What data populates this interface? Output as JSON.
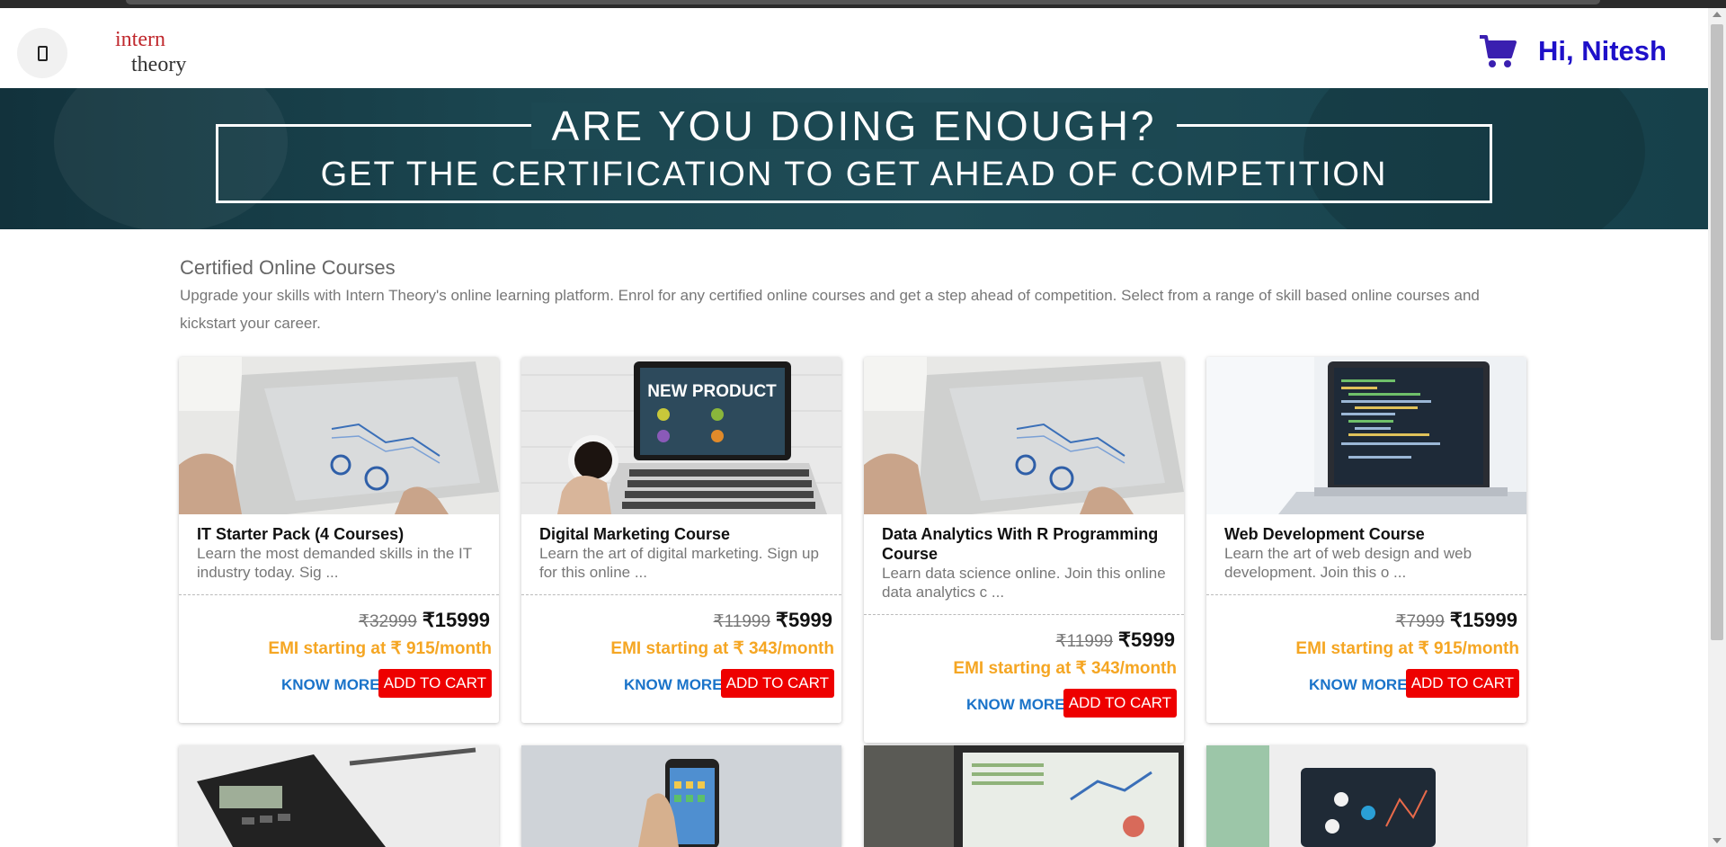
{
  "header": {
    "logo_text_line1": "intern",
    "logo_text_line2": "theory",
    "greeting": "Hi, Nitesh",
    "cart_icon": "shopping-cart-icon",
    "menu_icon": "menu-icon"
  },
  "banner": {
    "line1": "ARE YOU DOING ENOUGH?",
    "line2": "GET THE CERTIFICATION TO GET AHEAD OF COMPETITION"
  },
  "section": {
    "title": "Certified Online Courses",
    "description": "Upgrade your skills with Intern Theory's online learning platform. Enrol for any certified online courses and get a step ahead of competition. Select from a range of skill based online courses and kickstart your career."
  },
  "courses": [
    {
      "title": "IT Starter Pack (4 Courses)",
      "description": "Learn the most demanded skills in the IT industry today. Sig ...",
      "old_price": "₹32999",
      "new_price": "₹15999",
      "emi": "EMI starting at ₹ 915/month",
      "know_more": "KNOW MORE",
      "add_to_cart": "ADD TO CART"
    },
    {
      "title": "Digital Marketing Course",
      "description": "Learn the art of digital marketing. Sign up for this online ...",
      "old_price": "₹11999",
      "new_price": "₹5999",
      "emi": "EMI starting at ₹ 343/month",
      "know_more": "KNOW MORE",
      "add_to_cart": "ADD TO CART",
      "image_text": "NEW PRODUCT"
    },
    {
      "title": "Data Analytics With R Programming Course",
      "description": "Learn data science online. Join this online data analytics c ...",
      "old_price": "₹11999",
      "new_price": "₹5999",
      "emi": "EMI starting at ₹ 343/month",
      "know_more": "KNOW MORE",
      "add_to_cart": "ADD TO CART"
    },
    {
      "title": "Web Development Course",
      "description": "Learn the art of web design and web development. Join this o ...",
      "old_price": "₹7999",
      "new_price": "₹15999",
      "emi": "EMI starting at ₹ 915/month",
      "know_more": "KNOW MORE",
      "add_to_cart": "ADD TO CART"
    }
  ],
  "colors": {
    "greeting": "#1e10c9",
    "emi": "#f5a623",
    "know_more": "#1a73c9",
    "add_to_cart_bg": "#ee0000",
    "banner_bg": "#1c4852"
  }
}
